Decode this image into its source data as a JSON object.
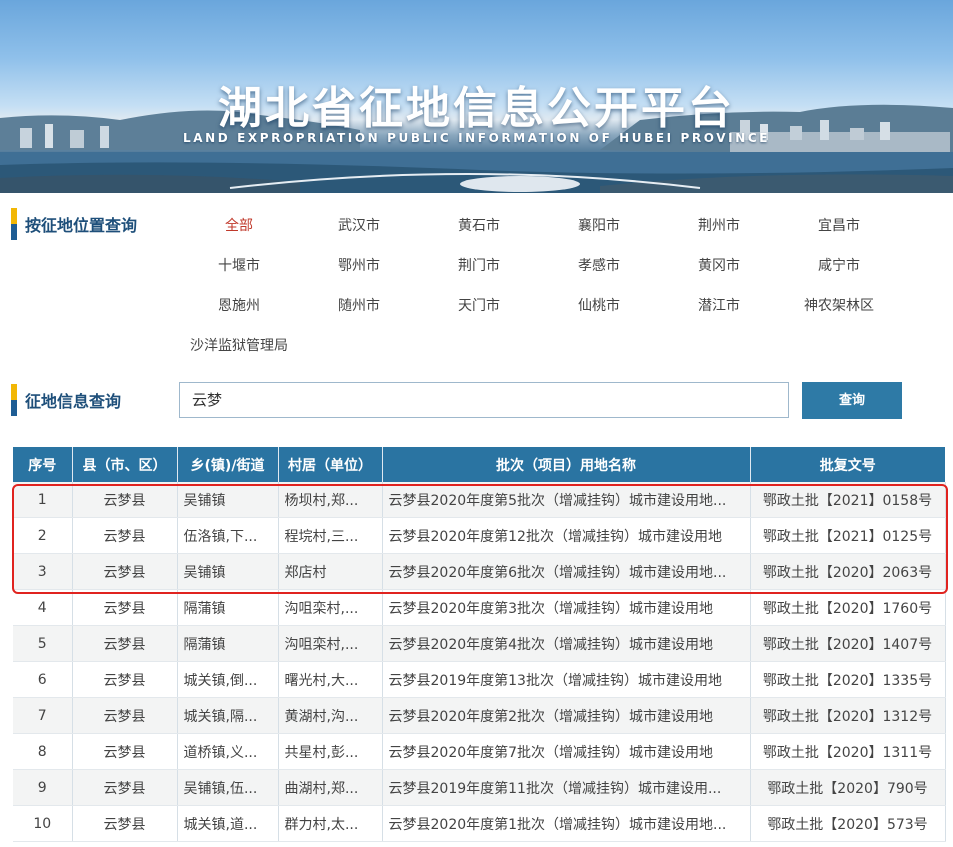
{
  "banner": {
    "title": "湖北省征地信息公开平台",
    "subtitle": "LAND EXPROPRIATION PUBLIC INFORMATION OF HUBEI PROVINCE"
  },
  "location": {
    "title": "按征地位置查询",
    "cities": [
      "全部",
      "武汉市",
      "黄石市",
      "襄阳市",
      "荆州市",
      "宜昌市",
      "十堰市",
      "鄂州市",
      "荆门市",
      "孝感市",
      "黄冈市",
      "咸宁市",
      "恩施州",
      "随州市",
      "天门市",
      "仙桃市",
      "潜江市",
      "神农架林区",
      "沙洋监狱管理局"
    ],
    "active": "全部"
  },
  "search": {
    "title": "征地信息查询",
    "value": "云梦",
    "button": "查询"
  },
  "table": {
    "headers": [
      "序号",
      "县（市、区）",
      "乡(镇)/街道",
      "村居（单位）",
      "批次（项目）用地名称",
      "批复文号"
    ],
    "rows": [
      [
        "1",
        "云梦县",
        "吴铺镇",
        "杨坝村,郑...",
        "云梦县2020年度第5批次（增减挂钩）城市建设用地...",
        "鄂政土批【2021】0158号"
      ],
      [
        "2",
        "云梦县",
        "伍洛镇,下...",
        "程垸村,三...",
        "云梦县2020年度第12批次（增减挂钩）城市建设用地",
        "鄂政土批【2021】0125号"
      ],
      [
        "3",
        "云梦县",
        "吴铺镇",
        "郑店村",
        "云梦县2020年度第6批次（增减挂钩）城市建设用地...",
        "鄂政土批【2020】2063号"
      ],
      [
        "4",
        "云梦县",
        "隔蒲镇",
        "沟咀栾村,...",
        "云梦县2020年度第3批次（增减挂钩）城市建设用地",
        "鄂政土批【2020】1760号"
      ],
      [
        "5",
        "云梦县",
        "隔蒲镇",
        "沟咀栾村,...",
        "云梦县2020年度第4批次（增减挂钩）城市建设用地",
        "鄂政土批【2020】1407号"
      ],
      [
        "6",
        "云梦县",
        "城关镇,倒...",
        "曙光村,大...",
        "云梦县2019年度第13批次（增减挂钩）城市建设用地",
        "鄂政土批【2020】1335号"
      ],
      [
        "7",
        "云梦县",
        "城关镇,隔...",
        "黄湖村,沟...",
        "云梦县2020年度第2批次（增减挂钩）城市建设用地",
        "鄂政土批【2020】1312号"
      ],
      [
        "8",
        "云梦县",
        "道桥镇,义...",
        "共星村,彭...",
        "云梦县2020年度第7批次（增减挂钩）城市建设用地",
        "鄂政土批【2020】1311号"
      ],
      [
        "9",
        "云梦县",
        "吴铺镇,伍...",
        "曲湖村,郑...",
        "云梦县2019年度第11批次（增减挂钩）城市建设用...",
        "鄂政土批【2020】790号"
      ],
      [
        "10",
        "云梦县",
        "城关镇,道...",
        "群力村,太...",
        "云梦县2020年度第1批次（增减挂钩）城市建设用地...",
        "鄂政土批【2020】573号"
      ]
    ]
  },
  "colors": {
    "header": "#2a74a2",
    "highlight": "#e0231f",
    "accent": "#f2b705",
    "active_city": "#c0392b"
  }
}
